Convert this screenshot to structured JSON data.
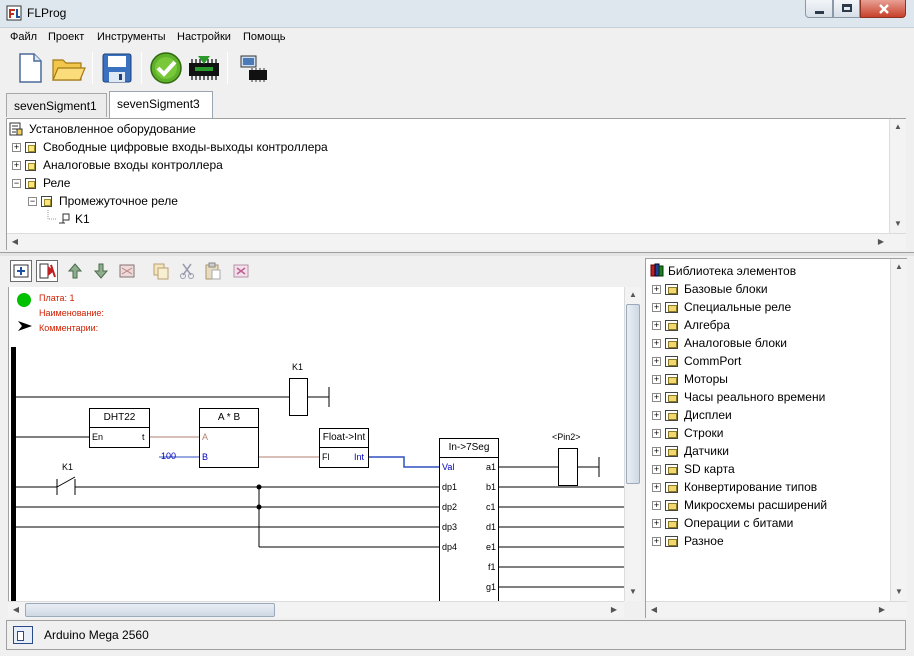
{
  "window": {
    "title": "FLProg",
    "icon": "flprog-app-icon",
    "controls": [
      "minimize-icon",
      "maximize-icon",
      "close-icon"
    ]
  },
  "menu": {
    "items": [
      "Файл",
      "Проект",
      "Инструменты",
      "Настройки",
      "Помощь"
    ]
  },
  "toolbar": {
    "buttons": [
      "new-file-icon",
      "open-folder-icon",
      "save-icon",
      "check-project-icon",
      "compile-board-icon",
      "upload-board-icon"
    ]
  },
  "tabs": [
    {
      "label": "sevenSigment1",
      "active": false
    },
    {
      "label": "sevenSigment3",
      "active": true
    }
  ],
  "hardware_tree": {
    "root": "Установленное оборудование",
    "items": [
      "Свободные цифровые входы-выходы контроллера",
      "Аналоговые входы контроллера",
      "Реле",
      "Промежуточное реле",
      "K1"
    ]
  },
  "canvas_toolbar": {
    "buttons": [
      "add-board-icon",
      "delete-board-icon",
      "move-up-icon",
      "move-down-icon",
      "board-properties-icon",
      "copy-icon",
      "cut-icon",
      "paste-icon",
      "delete-icon"
    ]
  },
  "diagram": {
    "board_info": {
      "board": "Плата: 1",
      "name": "Наименование:",
      "comments": "Комментарии:"
    },
    "coil_k1_label": "K1",
    "dht22": {
      "title": "DHT22",
      "pin_in": "En",
      "pin_out": "t"
    },
    "mult": {
      "title": "A * B",
      "pin_a": "A",
      "pin_b": "B",
      "const_b": "100"
    },
    "float_int": {
      "title": "Float->Int",
      "pin_in": "Fl",
      "pin_out": "Int"
    },
    "contact_k1_label": "K1",
    "seg": {
      "title": "In->7Seg",
      "inputs": [
        "Val",
        "dp1",
        "dp2",
        "dp3",
        "dp4"
      ],
      "outputs": [
        "a1",
        "b1",
        "c1",
        "d1",
        "e1",
        "f1",
        "g1"
      ]
    },
    "pin2_label": "<Pin2>"
  },
  "library": {
    "root": "Библиотека элементов",
    "items": [
      "Базовые блоки",
      "Специальные реле",
      "Алгебра",
      "Аналоговые блоки",
      "CommPort",
      "Моторы",
      "Часы реального времени",
      "Дисплеи",
      "Строки",
      "Датчики",
      "SD карта",
      "Конвертирование типов",
      "Микросхемы расширений",
      "Операции с битами",
      "Разное"
    ]
  },
  "status": {
    "text": "Arduino Mega 2560"
  },
  "colors": {
    "info_text": "#d02000",
    "link_blue": "#0000c0",
    "status_green": "#00c000",
    "wire_brown": "#b08070"
  }
}
